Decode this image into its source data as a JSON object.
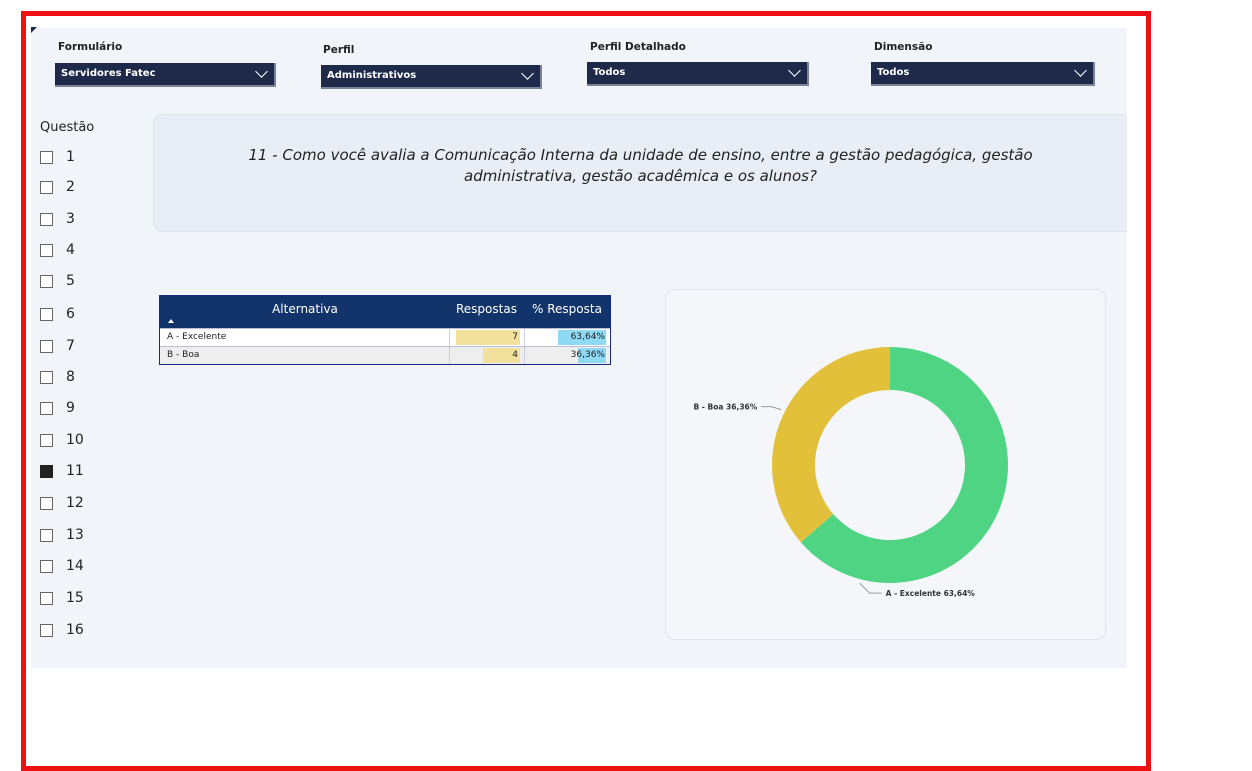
{
  "filters": [
    {
      "label": "Formulário",
      "value": "Servidores Fatec"
    },
    {
      "label": "Perfil",
      "value": "Administrativos"
    },
    {
      "label": "Perfil Detalhado",
      "value": "Todos"
    },
    {
      "label": "Dimensão",
      "value": "Todos"
    }
  ],
  "question_list": {
    "title": "Questão",
    "items": [
      "1",
      "2",
      "3",
      "4",
      "5",
      "6",
      "7",
      "8",
      "9",
      "10",
      "11",
      "12",
      "13",
      "14",
      "15",
      "16"
    ],
    "selected": "11"
  },
  "question_text": "11 - Como você avalia a Comunicação Interna da unidade de ensino, entre a gestão pedagógica, gestão administrativa, gestão acadêmica e os alunos?",
  "table": {
    "headers": [
      "Alternativa",
      "Respostas",
      "% Resposta"
    ],
    "rows": [
      {
        "alternativa": "A - Excelente",
        "respostas": "7",
        "percent": "63,64%",
        "fraction": 0.6364
      },
      {
        "alternativa": "B - Boa",
        "respostas": "4",
        "percent": "36,36%",
        "fraction": 0.3636
      }
    ]
  },
  "chart_data": {
    "type": "pie",
    "categories": [
      "A - Excelente",
      "B - Boa"
    ],
    "values": [
      63.64,
      36.36
    ],
    "labels": [
      "A - Excelente 63,64%",
      "B - Boa 36,36%"
    ],
    "colors": [
      "#4ed483",
      "#e2c03a"
    ]
  }
}
